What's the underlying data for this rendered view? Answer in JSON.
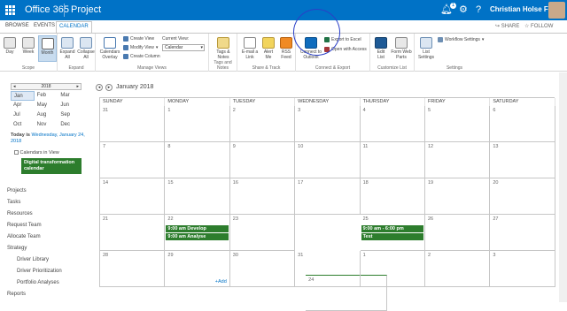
{
  "suite": {
    "brand": "Office 365",
    "site": "Project",
    "notif_count": "1",
    "user": "Christian Holse Fa...",
    "icons": [
      "app-launcher",
      "bell-icon",
      "gear-icon",
      "help-icon"
    ]
  },
  "ribbon_tabs": [
    {
      "label": "BROWSE"
    },
    {
      "label": "EVENTS"
    },
    {
      "label": "CALENDAR"
    }
  ],
  "share": {
    "share": "SHARE",
    "follow": "FOLLOW"
  },
  "ribbon": {
    "scope": {
      "label": "Scope",
      "day": "Day",
      "week": "Week",
      "month": "Month"
    },
    "expand": {
      "label": "Expand",
      "expand_all": "Expand All",
      "collapse_all": "Collapse All"
    },
    "manage": {
      "label": "Manage Views",
      "overlay": "Calendars Overlay",
      "create_view": "Create View",
      "modify_view": "Modify View",
      "create_column": "Create Column",
      "current_view_label": "Current View:",
      "current_view": "Calendar"
    },
    "tags": {
      "label": "Tags and Notes",
      "tags_notes": "Tags & Notes"
    },
    "share_track": {
      "label": "Share & Track",
      "email": "E-mail a Link",
      "alert": "Alert Me",
      "rss": "RSS Feed"
    },
    "connect": {
      "label": "Connect & Export",
      "outlook": "Connect to Outlook",
      "excel": "Export to Excel",
      "access": "Open with Access"
    },
    "customize": {
      "label": "Customize List",
      "edit": "Edit List",
      "form": "Form Web Parts"
    },
    "settings": {
      "label": "Settings",
      "list_settings": "List Settings",
      "workflow": "Workflow Settings"
    }
  },
  "mini_cal": {
    "year": "2018",
    "months": [
      "Jan",
      "Feb",
      "Mar",
      "Apr",
      "May",
      "Jun",
      "Jul",
      "Aug",
      "Sep",
      "Oct",
      "Nov",
      "Dec"
    ],
    "selected": "Jan"
  },
  "today_text": "Today is",
  "today_link": "Wednesday, January 24, 2018",
  "calendars_in_view": "Calendars in View",
  "digital_cal": "Digital transformation calendar",
  "nav": [
    {
      "label": "Projects"
    },
    {
      "label": "Tasks"
    },
    {
      "label": "Resources"
    },
    {
      "label": "Request Team"
    },
    {
      "label": "Allocate Team"
    },
    {
      "label": "Strategy"
    },
    {
      "label": "Driver Library"
    },
    {
      "label": "Driver Prioritization"
    },
    {
      "label": "Portfolio Analyses"
    },
    {
      "label": "Reports"
    }
  ],
  "calendar": {
    "title": "January 2018",
    "days": [
      "SUNDAY",
      "MONDAY",
      "TUESDAY",
      "WEDNESDAY",
      "THURSDAY",
      "FRIDAY",
      "SATURDAY"
    ],
    "weeks": [
      [
        "31",
        "1",
        "2",
        "3",
        "4",
        "5",
        "6"
      ],
      [
        "7",
        "8",
        "9",
        "10",
        "11",
        "12",
        "13"
      ],
      [
        "14",
        "15",
        "16",
        "17",
        "18",
        "19",
        "20"
      ],
      [
        "21",
        "22",
        "23",
        "24",
        "25",
        "26",
        "27"
      ],
      [
        "28",
        "29",
        "30",
        "31",
        "1",
        "2",
        "3"
      ]
    ],
    "events": [
      {
        "text": "9:00 am Develop"
      },
      {
        "text": "9:00 am Analyse"
      },
      {
        "text": "9:00 am - 6:00 pm"
      },
      {
        "text": "Test"
      }
    ],
    "add": "Add"
  }
}
